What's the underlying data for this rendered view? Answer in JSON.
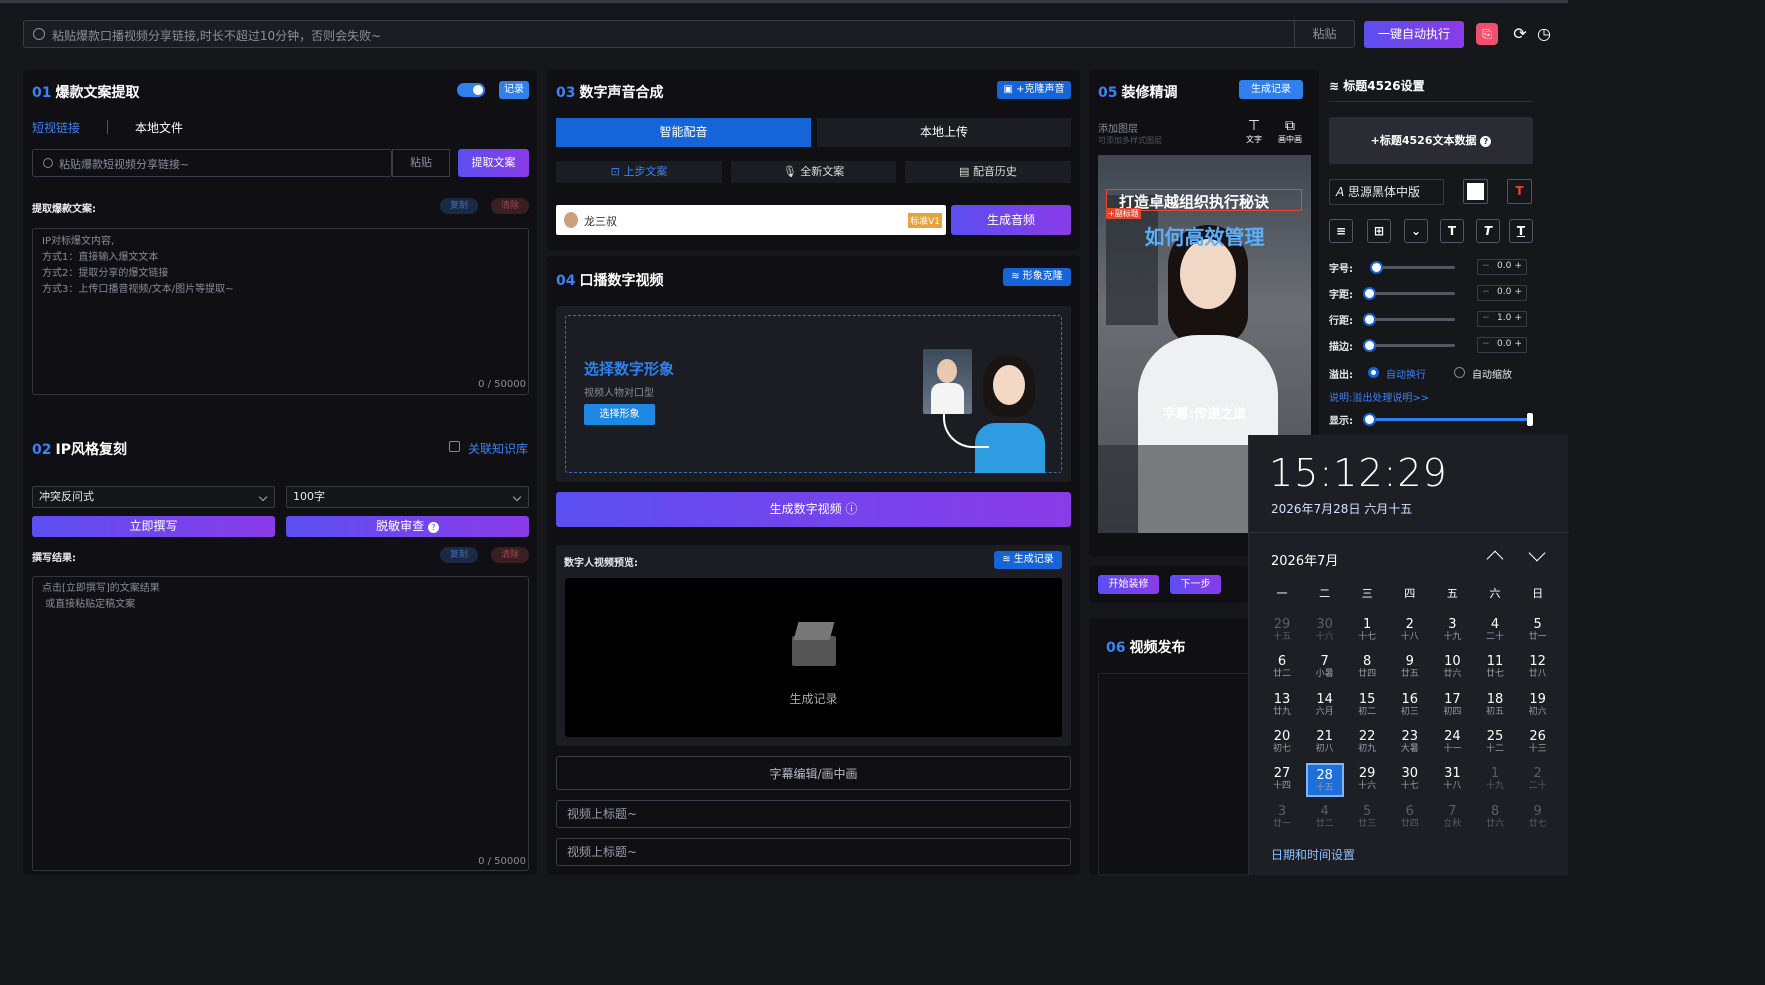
{
  "top": {
    "search_placeholder": "粘贴爆款口播视频分享链接,时长不超过10分钟，否则会失败~",
    "paste": "粘贴",
    "auto_exec": "一键自动执行"
  },
  "p01": {
    "num": "01",
    "title": "爆款文案提取",
    "record": "记录",
    "tab_short": "短视链接",
    "tab_local": "本地文件",
    "input_placeholder": "粘贴爆款短视频分享链接~",
    "paste": "粘贴",
    "extract": "提取文案",
    "label": "提取爆款文案:",
    "copy": "复制",
    "clear": "清除",
    "text_lines": [
      "IP对标爆文内容,",
      "方式1：直接输入爆文文本",
      "方式2：提取分享的爆文链接",
      "方式3：上传口播音视频/文本/图片等提取~"
    ],
    "count": "0 / 50000"
  },
  "p02": {
    "num": "02",
    "title": "IP风格复刻",
    "kb": "关联知识库",
    "style": "冲突反问式",
    "length": "100字",
    "rewrite": "立即撰写",
    "check": "脱敏审查",
    "label": "撰写结果:",
    "copy": "复制",
    "clear": "清除",
    "text_lines": [
      "点击[立即撰写]的文案结果",
      " 或直接粘贴定稿文案"
    ],
    "count": "0 / 50000"
  },
  "p03": {
    "num": "03",
    "title": "数字声音合成",
    "clone": "+克隆声音",
    "tab_smart": "智能配音",
    "tab_upload": "本地上传",
    "prev": "上步文案",
    "full": "全新文案",
    "history": "配音历史",
    "voice": "龙三叔",
    "voice_tag": "标准V1",
    "gen": "生成音频"
  },
  "p04": {
    "num": "04",
    "title": "口播数字视频",
    "clone": "形象克隆",
    "choose_title": "选择数字形象",
    "choose_sub": "视频人物对口型",
    "choose_btn": "选择形象",
    "gen": "生成数字视频",
    "preview": "数字人视频预览:",
    "records": "生成记录",
    "records_center": "生成记录",
    "subtitle_edit": "字幕编辑/画中画",
    "title1_placeholder": "视频上标题~",
    "title2_placeholder": "视频上标题~"
  },
  "p05": {
    "num": "05",
    "title": "装修精调",
    "records": "生成记录",
    "add_layer": "添加图层",
    "add_sub": "可添加多样式图层",
    "tool_text": "文字",
    "tool_pip": "画中画",
    "headline1": "打造卓越组织执行秘诀",
    "tag": "+副标题",
    "headline2": "如何高效管理",
    "caption": "字幕:传递之道",
    "start": "开始装修",
    "next": "下一步"
  },
  "p06": {
    "num": "06",
    "title": "视频发布"
  },
  "settings": {
    "title": "标题4526设置",
    "add_data": "+标题4526文本数据",
    "font": "思源黑体中版",
    "size_label": "字号:",
    "spacing_label": "字距:",
    "line_label": "行距:",
    "stroke_label": "描边:",
    "size_val": "0.0",
    "spacing_val": "0.0",
    "line_val": "1.0",
    "stroke_val": "0.0",
    "overflow_label": "溢出:",
    "wrap": "自动换行",
    "shrink": "自动缩放",
    "help": "说明:溢出处理说明>>",
    "show_label": "显示:",
    "show_level": 1.0
  },
  "calendar": {
    "time": "15:12:29",
    "date": "2026年7月28日 六月十五",
    "month": "2026年7月",
    "weekdays": [
      "一",
      "二",
      "三",
      "四",
      "五",
      "六",
      "日"
    ],
    "days": [
      [
        "29",
        "十五",
        1
      ],
      [
        "30",
        "十六",
        1
      ],
      [
        "1",
        "十七",
        0
      ],
      [
        "2",
        "十八",
        0
      ],
      [
        "3",
        "十九",
        0
      ],
      [
        "4",
        "二十",
        0
      ],
      [
        "5",
        "廿一",
        0
      ],
      [
        "6",
        "廿二",
        0
      ],
      [
        "7",
        "小暑",
        0
      ],
      [
        "8",
        "廿四",
        0
      ],
      [
        "9",
        "廿五",
        0
      ],
      [
        "10",
        "廿六",
        0
      ],
      [
        "11",
        "廿七",
        0
      ],
      [
        "12",
        "廿八",
        0
      ],
      [
        "13",
        "廿九",
        0
      ],
      [
        "14",
        "六月",
        0
      ],
      [
        "15",
        "初二",
        0
      ],
      [
        "16",
        "初三",
        0
      ],
      [
        "17",
        "初四",
        0
      ],
      [
        "18",
        "初五",
        0
      ],
      [
        "19",
        "初六",
        0
      ],
      [
        "20",
        "初七",
        0
      ],
      [
        "21",
        "初八",
        0
      ],
      [
        "22",
        "初九",
        0
      ],
      [
        "23",
        "大暑",
        0
      ],
      [
        "24",
        "十一",
        0
      ],
      [
        "25",
        "十二",
        0
      ],
      [
        "26",
        "十三",
        0
      ],
      [
        "27",
        "十四",
        0
      ],
      [
        "28",
        "十五",
        2
      ],
      [
        "29",
        "十六",
        0
      ],
      [
        "30",
        "十七",
        0
      ],
      [
        "31",
        "十八",
        0
      ],
      [
        "1",
        "十九",
        1
      ],
      [
        "2",
        "二十",
        1
      ],
      [
        "3",
        "廿一",
        1
      ],
      [
        "4",
        "廿二",
        1
      ],
      [
        "5",
        "廿三",
        1
      ],
      [
        "6",
        "廿四",
        1
      ],
      [
        "7",
        "立秋",
        1
      ],
      [
        "8",
        "廿六",
        1
      ],
      [
        "9",
        "廿七",
        1
      ]
    ],
    "settings_link": "日期和时间设置"
  },
  "colors": {
    "accent": "#1565d8",
    "grad_start": "#5b4ff0",
    "grad_end": "#8a3be8"
  }
}
